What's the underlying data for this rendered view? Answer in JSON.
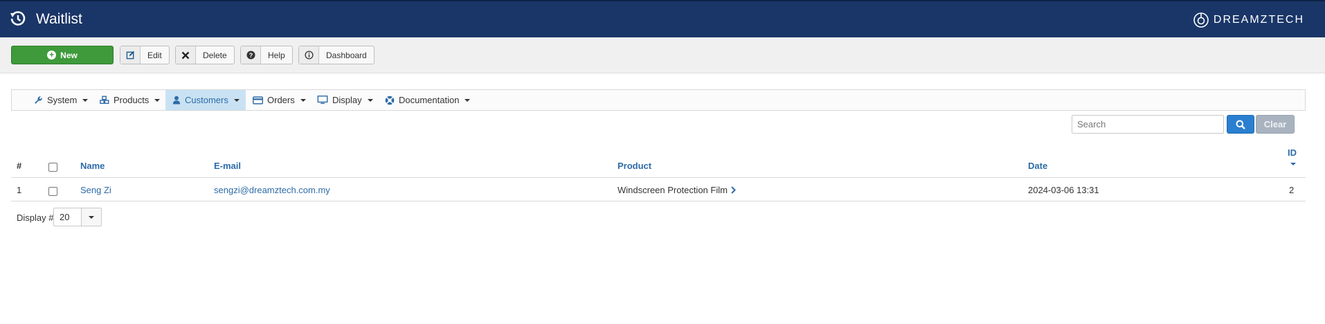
{
  "header": {
    "title": "Waitlist",
    "brand": "DREAMZTECH",
    "colors": {
      "bar": "#1a3668"
    }
  },
  "toolbar": {
    "new_label": "New",
    "edit_label": "Edit",
    "delete_label": "Delete",
    "help_label": "Help",
    "dashboard_label": "Dashboard"
  },
  "menu": {
    "items": [
      {
        "label": "System",
        "icon": "wrench-icon"
      },
      {
        "label": "Products",
        "icon": "cubes-icon"
      },
      {
        "label": "Customers",
        "icon": "user-icon",
        "active": true
      },
      {
        "label": "Orders",
        "icon": "credit-card-icon"
      },
      {
        "label": "Display",
        "icon": "monitor-icon"
      },
      {
        "label": "Documentation",
        "icon": "lifebuoy-icon"
      }
    ]
  },
  "search": {
    "placeholder": "Search",
    "clear_label": "Clear"
  },
  "table": {
    "columns": {
      "hash": "#",
      "name": "Name",
      "email": "E-mail",
      "product": "Product",
      "date": "Date",
      "id": "ID"
    },
    "rows": [
      {
        "num": "1",
        "name": "Seng Zi",
        "email": "sengzi@dreamztech.com.my",
        "product": "Windscreen Protection Film",
        "date": "2024-03-06 13:31",
        "id": "2"
      }
    ]
  },
  "pagination": {
    "display_label": "Display #",
    "limit": "20"
  }
}
